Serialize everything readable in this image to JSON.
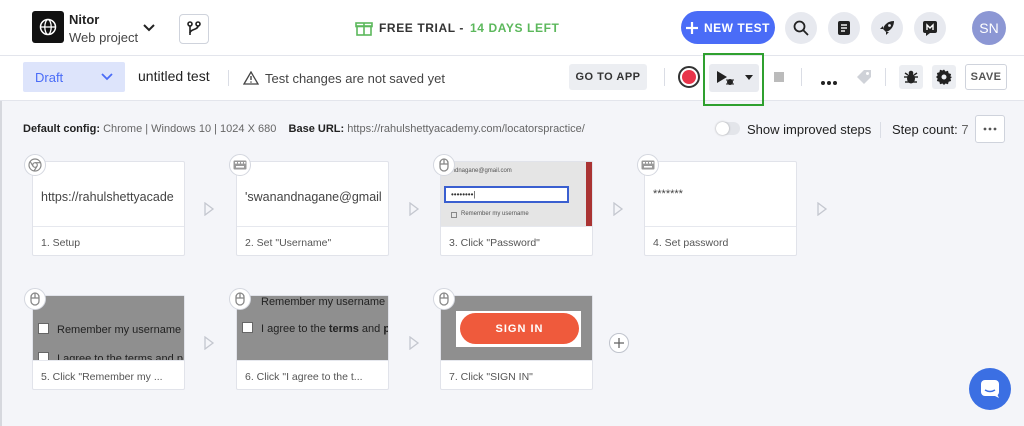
{
  "header": {
    "project_name": "Nitor",
    "project_type": "Web project",
    "trial_label": "FREE TRIAL -",
    "trial_days": "14 DAYS LEFT",
    "new_test_label": "NEW TEST",
    "avatar_initials": "SN"
  },
  "toolbar": {
    "status_select": "Draft",
    "test_name": "untitled test",
    "unsaved_warning": "Test changes are not saved yet",
    "goto_app_label": "GO TO APP",
    "save_label": "SAVE"
  },
  "info": {
    "default_config_label": "Default config:",
    "default_config_value": "Chrome | Windows 10 | 1024 X 680",
    "base_url_label": "Base URL:",
    "base_url_value": "https://rahulshettyacademy.com/locatorspractice/",
    "improved_steps_label": "Show improved steps",
    "step_count_label": "Step count:",
    "step_count_value": "7"
  },
  "steps": [
    {
      "caption": "1. Setup",
      "thumb_text": "https://rahulshettyacade",
      "icon": "chrome-icon"
    },
    {
      "caption": "2. Set \"Username\"",
      "thumb_text": "'swanandnagane@gmail",
      "icon": "keyboard-icon"
    },
    {
      "caption": "3. Click \"Password\"",
      "thumb_text": "nandnagane@gmail.com",
      "thumb_text2": "Remember my username",
      "icon": "mouse-icon"
    },
    {
      "caption": "4. Set password",
      "thumb_text": "*******",
      "icon": "keyboard-icon"
    },
    {
      "caption": "5. Click \"Remember my ...",
      "thumb_text": "Remember my username",
      "thumb_text2": "I agree to the terms and p",
      "icon": "mouse-icon"
    },
    {
      "caption": "6. Click \"I agree to the t...",
      "thumb_text": "Remember my username",
      "thumb_text2a": "I agree to the ",
      "thumb_text2b": "terms",
      "thumb_text2c": " and ",
      "thumb_text2d": "p",
      "icon": "mouse-icon"
    },
    {
      "caption": "7. Click \"SIGN IN\"",
      "thumb_text": "SIGN IN",
      "icon": "mouse-icon"
    }
  ],
  "colors": {
    "accent": "#4a6cf7",
    "record": "#e8344a",
    "highlight": "#2fa02f",
    "trial_green": "#5cb85c",
    "signin_button": "#ef5a3c"
  }
}
